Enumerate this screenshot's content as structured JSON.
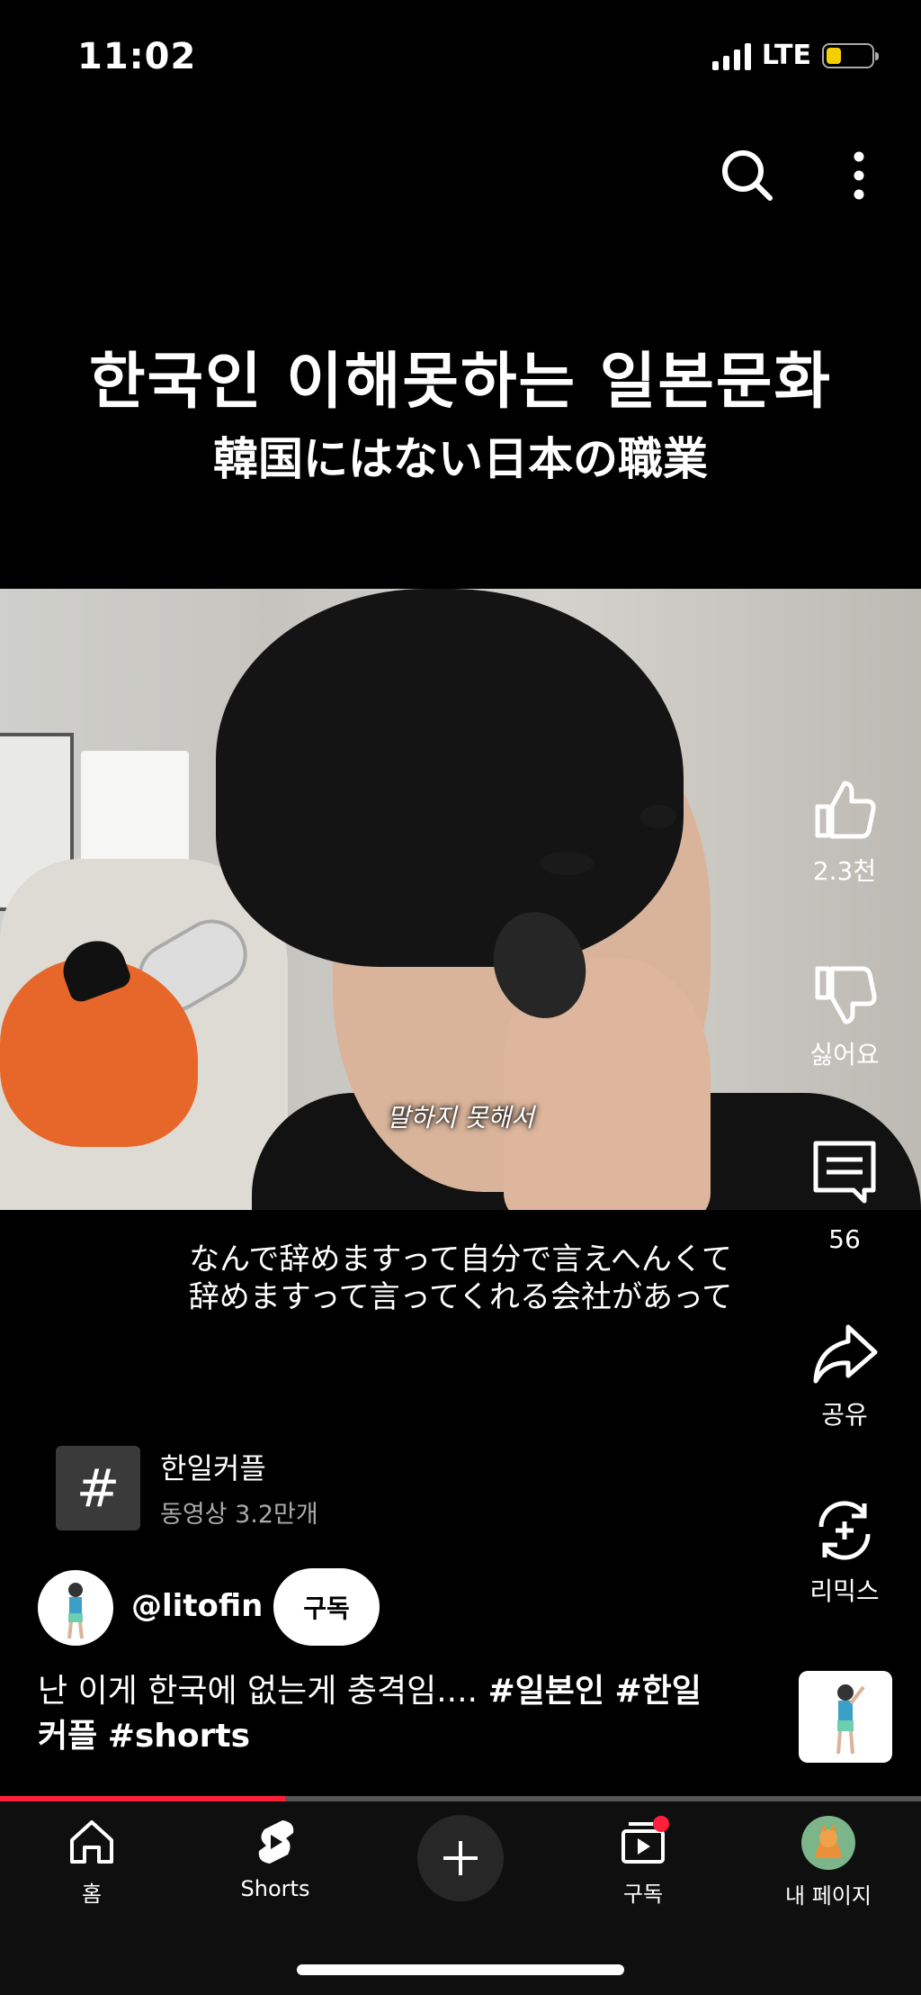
{
  "status_bar": {
    "time": "11:02",
    "network": "LTE",
    "battery_color": "#f5d000"
  },
  "overlay": {
    "title_ko": "한국인 이해못하는 일본문화",
    "title_jp": "韓国にはない日本の職業"
  },
  "video": {
    "subtitle_in_frame": "말하지 못해서",
    "caption_lines": [
      "なんで辞めますって自分で言えへんくて",
      "辞めますって言ってくれる会社があって"
    ]
  },
  "actions": {
    "like": {
      "icon": "thumbs-up-icon",
      "label": "2.3천"
    },
    "dislike": {
      "icon": "thumbs-down-icon",
      "label": "싫어요"
    },
    "comments": {
      "icon": "comment-icon",
      "label": "56"
    },
    "share": {
      "icon": "share-icon",
      "label": "공유"
    },
    "remix": {
      "icon": "remix-icon",
      "label": "리믹스"
    }
  },
  "hashtag_card": {
    "symbol": "#",
    "name": "한일커플",
    "count": "동영상 3.2만개"
  },
  "channel": {
    "handle": "@litofin",
    "subscribe_label": "구독"
  },
  "description": {
    "text": "난 이게 한국에 없는게 충격임....",
    "tags": [
      "#일본인",
      "#한일",
      "커플",
      "#shorts"
    ]
  },
  "playback": {
    "progress_fraction": 0.31,
    "progress_color": "#ff1f3a"
  },
  "bottom_nav": {
    "home": "홈",
    "shorts": "Shorts",
    "subscriptions": "구독",
    "my_page": "내 페이지"
  }
}
